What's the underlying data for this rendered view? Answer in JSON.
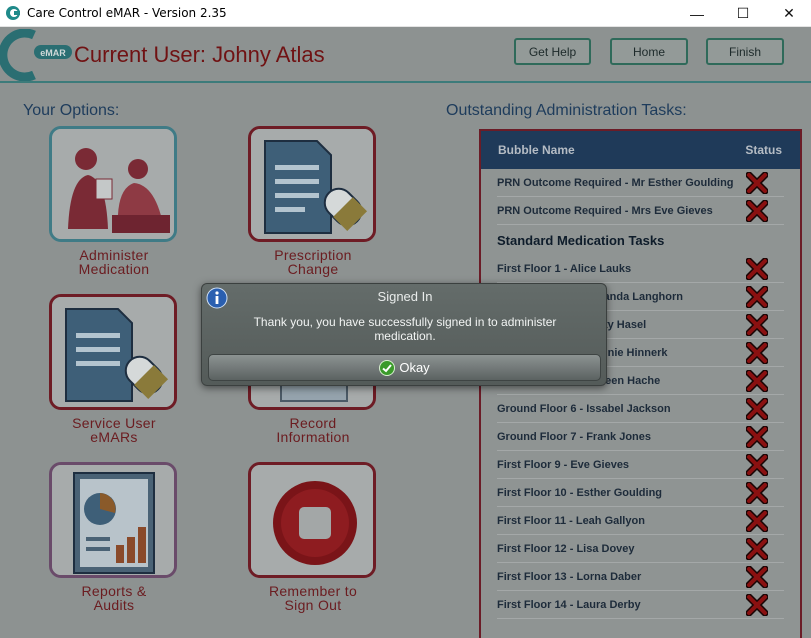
{
  "window": {
    "title": "Care Control eMAR - Version 2.35",
    "minimize_glyph": "—",
    "maximize_glyph": "☐",
    "close_glyph": "✕"
  },
  "header": {
    "logo_text": "eMAR",
    "current_user": "Current User: Johny Atlas",
    "help_label": "Get Help",
    "home_label": "Home",
    "finish_label": "Finish"
  },
  "options": {
    "title": "Your Options:",
    "tiles": [
      {
        "line1": "Administer",
        "line2": "Medication",
        "icon": "nurse-patient-icon"
      },
      {
        "line1": "Prescription",
        "line2": "Change",
        "icon": "prescription-pill-icon"
      },
      {
        "line1": "Service User",
        "line2": "eMARs",
        "icon": "document-pill-icon"
      },
      {
        "line1": "Record",
        "line2": "Information",
        "icon": "record-document-icon"
      },
      {
        "line1": "Reports &",
        "line2": "Audits",
        "icon": "report-chart-icon"
      },
      {
        "line1": "Remember to",
        "line2": "Sign Out",
        "icon": "stop-button-icon"
      }
    ]
  },
  "tasks": {
    "title": "Outstanding Administration Tasks:",
    "col_name": "Bubble Name",
    "col_status": "Status",
    "prn_rows": [
      "PRN Outcome Required - Mr Esther Goulding",
      "PRN Outcome Required - Mrs Eve Gieves"
    ],
    "subheading": "Standard Medication Tasks",
    "standard_rows": [
      "First Floor 1 - Alice Lauks",
      "Ground Floor 2 - Amanda Langhorn",
      "Ground Floor 3 - Betty Hasel",
      "Ground Floor 4 - Bonnie Hinnerk",
      "Ground Floor 5 - Doreen Hache",
      "Ground Floor 6 - Issabel Jackson",
      "Ground Floor 7 - Frank Jones",
      "First Floor 9 - Eve Gieves",
      "First Floor 10 - Esther Goulding",
      "First Floor 11 - Leah Gallyon",
      "First Floor 12 - Lisa Dovey",
      "First Floor 13 - Lorna Daber",
      "First Floor 14 - Laura Derby"
    ],
    "status_icon": "red-x-icon"
  },
  "dialog": {
    "title": "Signed In",
    "message": "Thank you, you have successfully signed in to administer medication.",
    "ok_label": "Okay",
    "icon": "info-icon"
  },
  "colors": {
    "accent_teal": "#3c7b7a",
    "brand_red": "#701213",
    "table_header": "#1f3a59",
    "status_x": "#8a1010"
  }
}
